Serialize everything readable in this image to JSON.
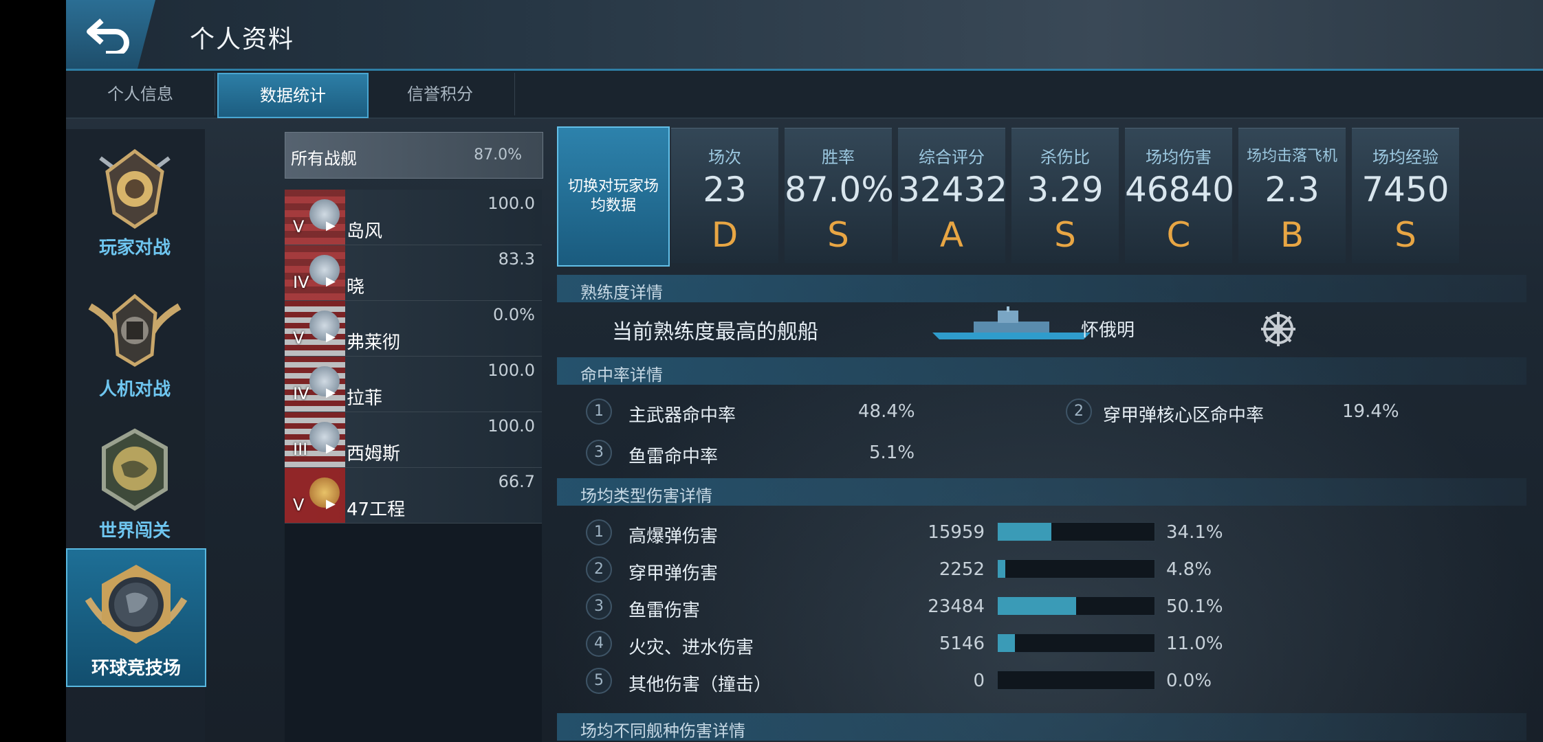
{
  "header": {
    "title": "个人资料"
  },
  "tabs": [
    {
      "label": "个人信息",
      "active": false
    },
    {
      "label": "数据统计",
      "active": true
    },
    {
      "label": "信誉积分",
      "active": false
    }
  ],
  "modes": [
    {
      "label": "玩家对战",
      "active": false
    },
    {
      "label": "人机对战",
      "active": false
    },
    {
      "label": "世界闯关",
      "active": false
    },
    {
      "label": "环球竞技场",
      "active": true
    }
  ],
  "ship_filter": {
    "label": "所有战舰",
    "value": "87.0%"
  },
  "ships": [
    {
      "tier": "V",
      "name": "岛风",
      "value": "100.0"
    },
    {
      "tier": "IV",
      "name": "晓",
      "value": "83.3"
    },
    {
      "tier": "V",
      "name": "弗莱彻",
      "value": "0.0%"
    },
    {
      "tier": "IV",
      "name": "拉菲",
      "value": "100.0"
    },
    {
      "tier": "III",
      "name": "西姆斯",
      "value": "100.0"
    },
    {
      "tier": "V",
      "name": "47工程",
      "value": "66.7"
    }
  ],
  "switch_button": "切换对玩家场均数据",
  "stats": [
    {
      "label": "场次",
      "value": "23",
      "grade": "D"
    },
    {
      "label": "胜率",
      "value": "87.0%",
      "grade": "S"
    },
    {
      "label": "综合评分",
      "value": "32432",
      "grade": "A"
    },
    {
      "label": "杀伤比",
      "value": "3.29",
      "grade": "S"
    },
    {
      "label": "场均伤害",
      "value": "46840",
      "grade": "C"
    },
    {
      "label": "场均击落飞机",
      "value": "2.3",
      "grade": "B"
    },
    {
      "label": "场均经验",
      "value": "7450",
      "grade": "S"
    }
  ],
  "proficiency": {
    "section": "熟练度详情",
    "label": "当前熟练度最高的舰船",
    "ship": "怀俄明"
  },
  "hitrate": {
    "section": "命中率详情",
    "items": [
      {
        "num": "1",
        "label": "主武器命中率",
        "value": "48.4%"
      },
      {
        "num": "2",
        "label": "穿甲弹核心区命中率",
        "value": "19.4%"
      },
      {
        "num": "3",
        "label": "鱼雷命中率",
        "value": "5.1%"
      }
    ]
  },
  "damage": {
    "section": "场均类型伤害详情",
    "items": [
      {
        "num": "1",
        "label": "高爆弹伤害",
        "value": "15959",
        "pct": "34.1%",
        "fraction": 0.341
      },
      {
        "num": "2",
        "label": "穿甲弹伤害",
        "value": "2252",
        "pct": "4.8%",
        "fraction": 0.048
      },
      {
        "num": "3",
        "label": "鱼雷伤害",
        "value": "23484",
        "pct": "50.1%",
        "fraction": 0.501
      },
      {
        "num": "4",
        "label": "火灾、进水伤害",
        "value": "5146",
        "pct": "11.0%",
        "fraction": 0.11
      },
      {
        "num": "5",
        "label": "其他伤害（撞击）",
        "value": "0",
        "pct": "0.0%",
        "fraction": 0.0
      }
    ]
  },
  "shiptype_section": "场均不同舰种伤害详情"
}
